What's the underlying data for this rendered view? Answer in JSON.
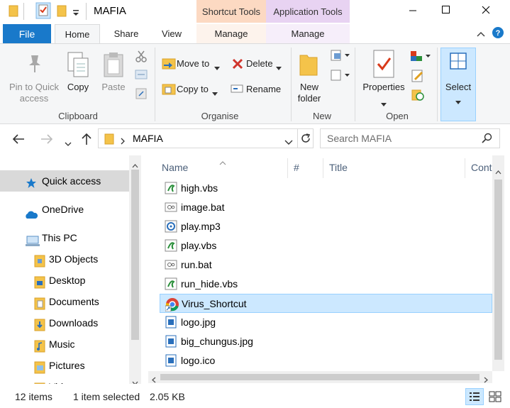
{
  "title": "MAFIA",
  "context_tabs": {
    "shortcut_tools": "Shortcut Tools",
    "application_tools": "Application Tools"
  },
  "tabs": {
    "file": "File",
    "home": "Home",
    "share": "Share",
    "view": "View",
    "manage1": "Manage",
    "manage2": "Manage"
  },
  "ribbon": {
    "clipboard": {
      "pin": "Pin to Quick access",
      "copy": "Copy",
      "paste": "Paste",
      "group": "Clipboard"
    },
    "organise": {
      "move_to": "Move to",
      "copy_to": "Copy to",
      "delete": "Delete",
      "rename": "Rename",
      "group": "Organise"
    },
    "new": {
      "new_folder": "New folder",
      "group": "New"
    },
    "open": {
      "properties": "Properties",
      "group": "Open"
    },
    "select": {
      "select": "Select"
    }
  },
  "address": {
    "path": "MAFIA",
    "search_placeholder": "Search MAFIA"
  },
  "nav": {
    "quick_access": "Quick access",
    "onedrive": "OneDrive",
    "this_pc": "This PC",
    "objects3d": "3D Objects",
    "desktop": "Desktop",
    "documents": "Documents",
    "downloads": "Downloads",
    "music": "Music",
    "pictures": "Pictures",
    "videos": "Videos"
  },
  "columns": {
    "name": "Name",
    "number": "#",
    "title": "Title",
    "contributing": "Cont"
  },
  "files": [
    {
      "name": "high.vbs",
      "icon": "vbs-script-icon"
    },
    {
      "name": "image.bat",
      "icon": "bat-file-icon"
    },
    {
      "name": "play.mp3",
      "icon": "audio-file-icon"
    },
    {
      "name": "play.vbs",
      "icon": "vbs-script-icon"
    },
    {
      "name": "run.bat",
      "icon": "bat-file-icon"
    },
    {
      "name": "run_hide.vbs",
      "icon": "vbs-script-icon"
    },
    {
      "name": "Virus_Shortcut",
      "icon": "chrome-shortcut-icon"
    },
    {
      "name": "logo.jpg",
      "icon": "image-file-icon"
    },
    {
      "name": "big_chungus.jpg",
      "icon": "image-file-icon"
    },
    {
      "name": "logo.ico",
      "icon": "image-file-icon"
    }
  ],
  "status": {
    "items": "12 items",
    "selected": "1 item selected",
    "size": "2.05 KB"
  },
  "colors": {
    "accent": "#1979ca",
    "selection": "#cce8ff",
    "shortcut_tools": "#fcd9c2",
    "application_tools": "#e8d3f2"
  }
}
